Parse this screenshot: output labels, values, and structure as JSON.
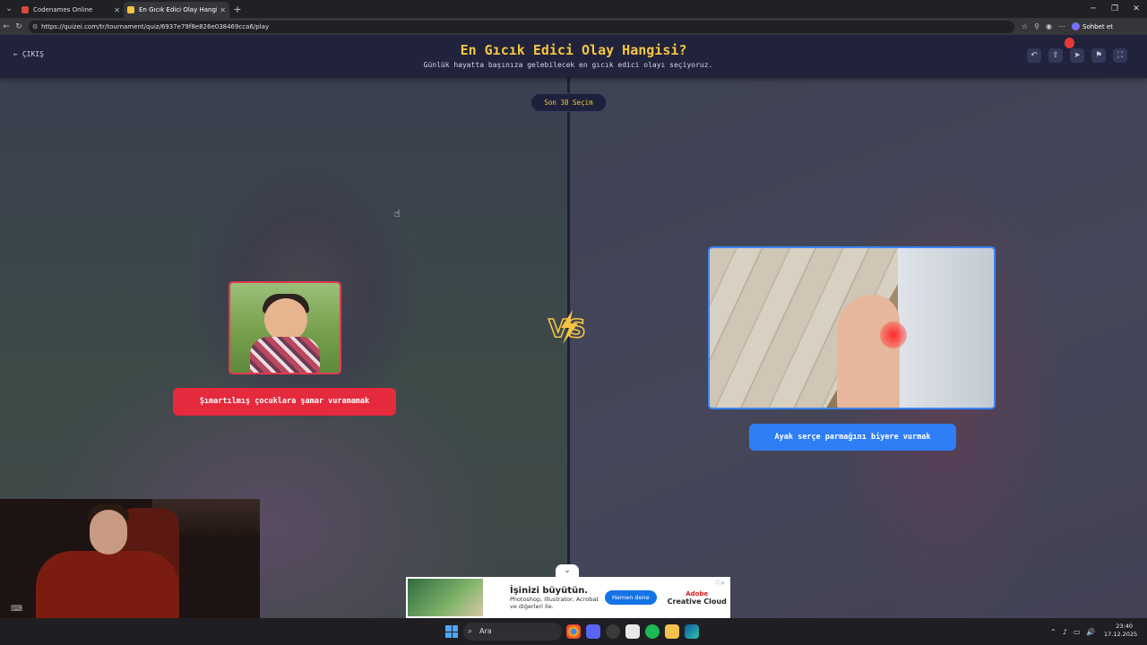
{
  "browser": {
    "tabs": [
      {
        "title": "Codenames Online",
        "favicon_color": "#d24b3e"
      },
      {
        "title": "En Gıcık Edici Olay Hangisi? - Tier",
        "favicon_color": "#f5c542"
      }
    ],
    "url": "https://quizei.com/tr/tournament/quiz/6937e79f8e826e038469cca6/play",
    "chat_label": "Sohbet et"
  },
  "header": {
    "back_label": "ÇIKIŞ",
    "title": "En Gıcık Edici Olay Hangisi?",
    "subtitle": "Günlük hayatta başınıza gelebilecek en gıcık edici olayı seçiyoruz.",
    "accent_color": "#f5c542"
  },
  "tournament": {
    "round_label": "Son 38 Seçim",
    "left_option": {
      "label": "Şımartılmış çocuklara şamar vuramamak",
      "color": "#e52a3d"
    },
    "right_option": {
      "label": "Ayak serçe parmağını biyere vurmak",
      "color": "#2f7ef6"
    },
    "versus_label": "VS"
  },
  "ad": {
    "headline": "İşinizi büyütün.",
    "body": "Photoshop, Illustrator, Acrobat ve diğerleri ile.",
    "button": "Hemen dene",
    "brand_top": "Adobe",
    "brand_bottom": "Creative Cloud"
  },
  "taskbar": {
    "search_label": "Ara",
    "time": "23:40",
    "date": "17.12.2025"
  }
}
